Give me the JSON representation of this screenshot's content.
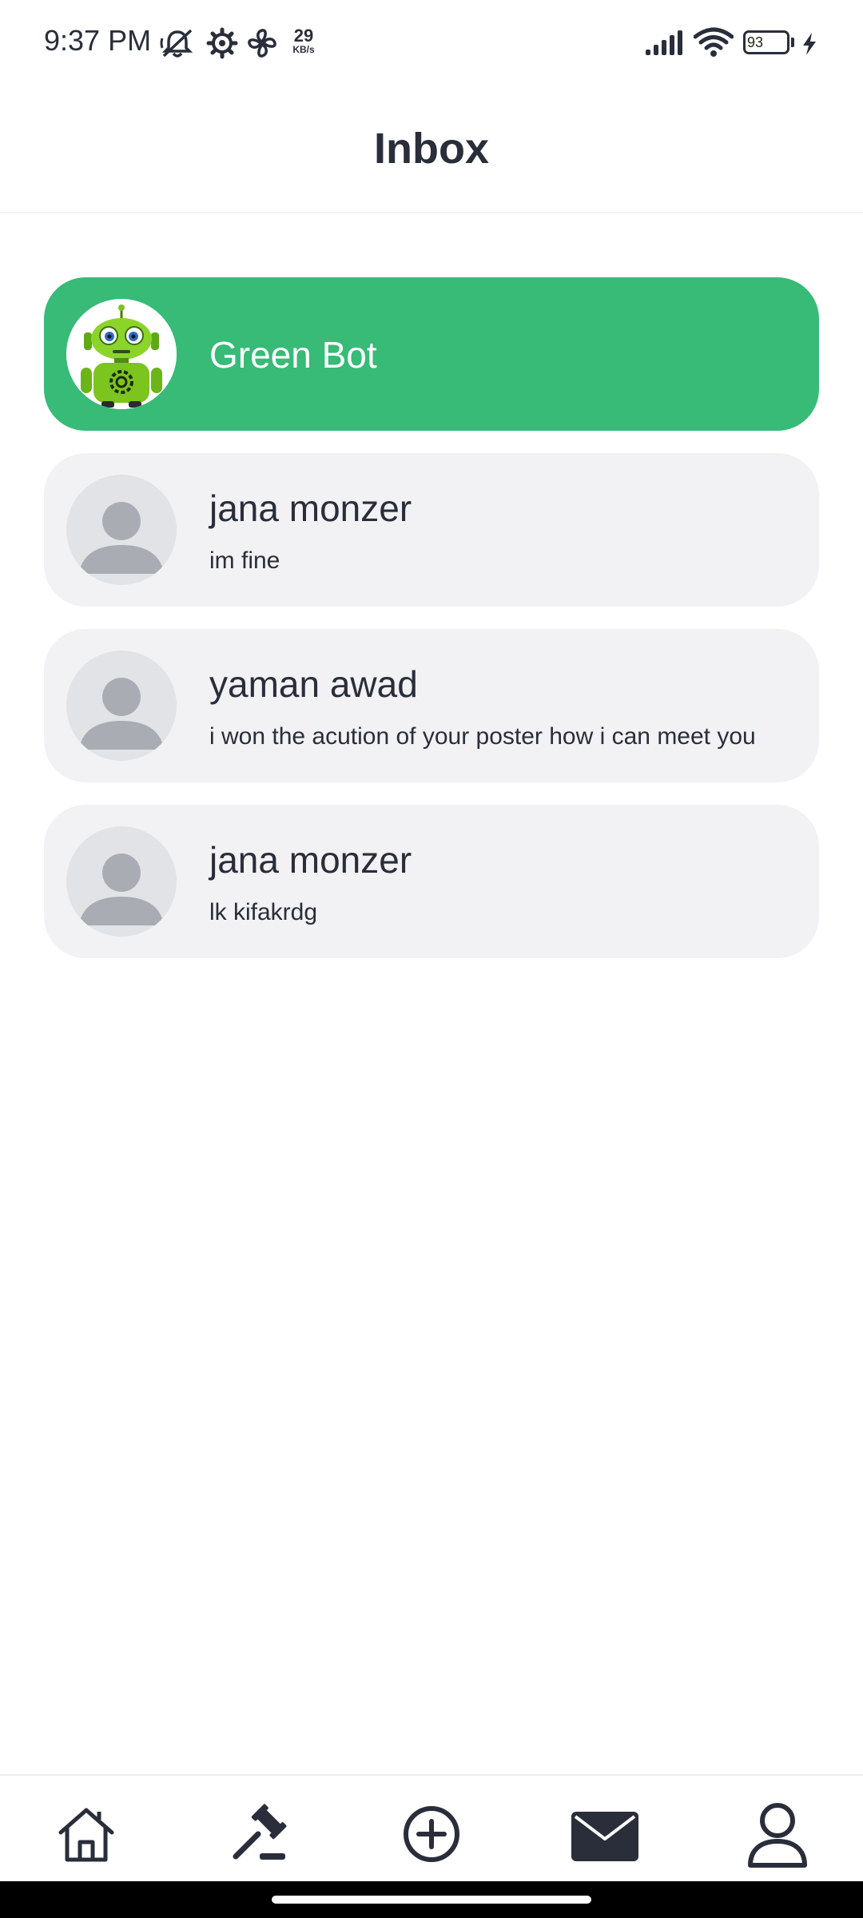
{
  "status_bar": {
    "time": "9:37 PM",
    "speed_value": "29",
    "speed_unit": "KB/s",
    "battery": "93",
    "icons": [
      "mute-icon",
      "settings-icon",
      "fan-icon",
      "signal-icon",
      "wifi-icon",
      "battery-icon",
      "charging-icon"
    ]
  },
  "header": {
    "title": "Inbox"
  },
  "chats": [
    {
      "name": "Green Bot",
      "preview": "",
      "avatar": "robot-avatar",
      "highlighted": true,
      "color": "#37bb77"
    },
    {
      "name": "jana monzer",
      "preview": "im fine",
      "avatar": "person-avatar"
    },
    {
      "name": "yaman awad",
      "preview": "i won the acution of your poster how i can meet you",
      "avatar": "person-avatar"
    },
    {
      "name": "jana monzer",
      "preview": "lk kifakrdg",
      "avatar": "person-avatar"
    }
  ],
  "nav": {
    "items": [
      "home-icon",
      "gavel-icon",
      "add-circle-icon",
      "mail-icon",
      "profile-icon"
    ],
    "active": "mail-icon"
  },
  "colors": {
    "accent": "#37bb77",
    "card": "#f2f2f4",
    "text": "#2a2d3a"
  }
}
